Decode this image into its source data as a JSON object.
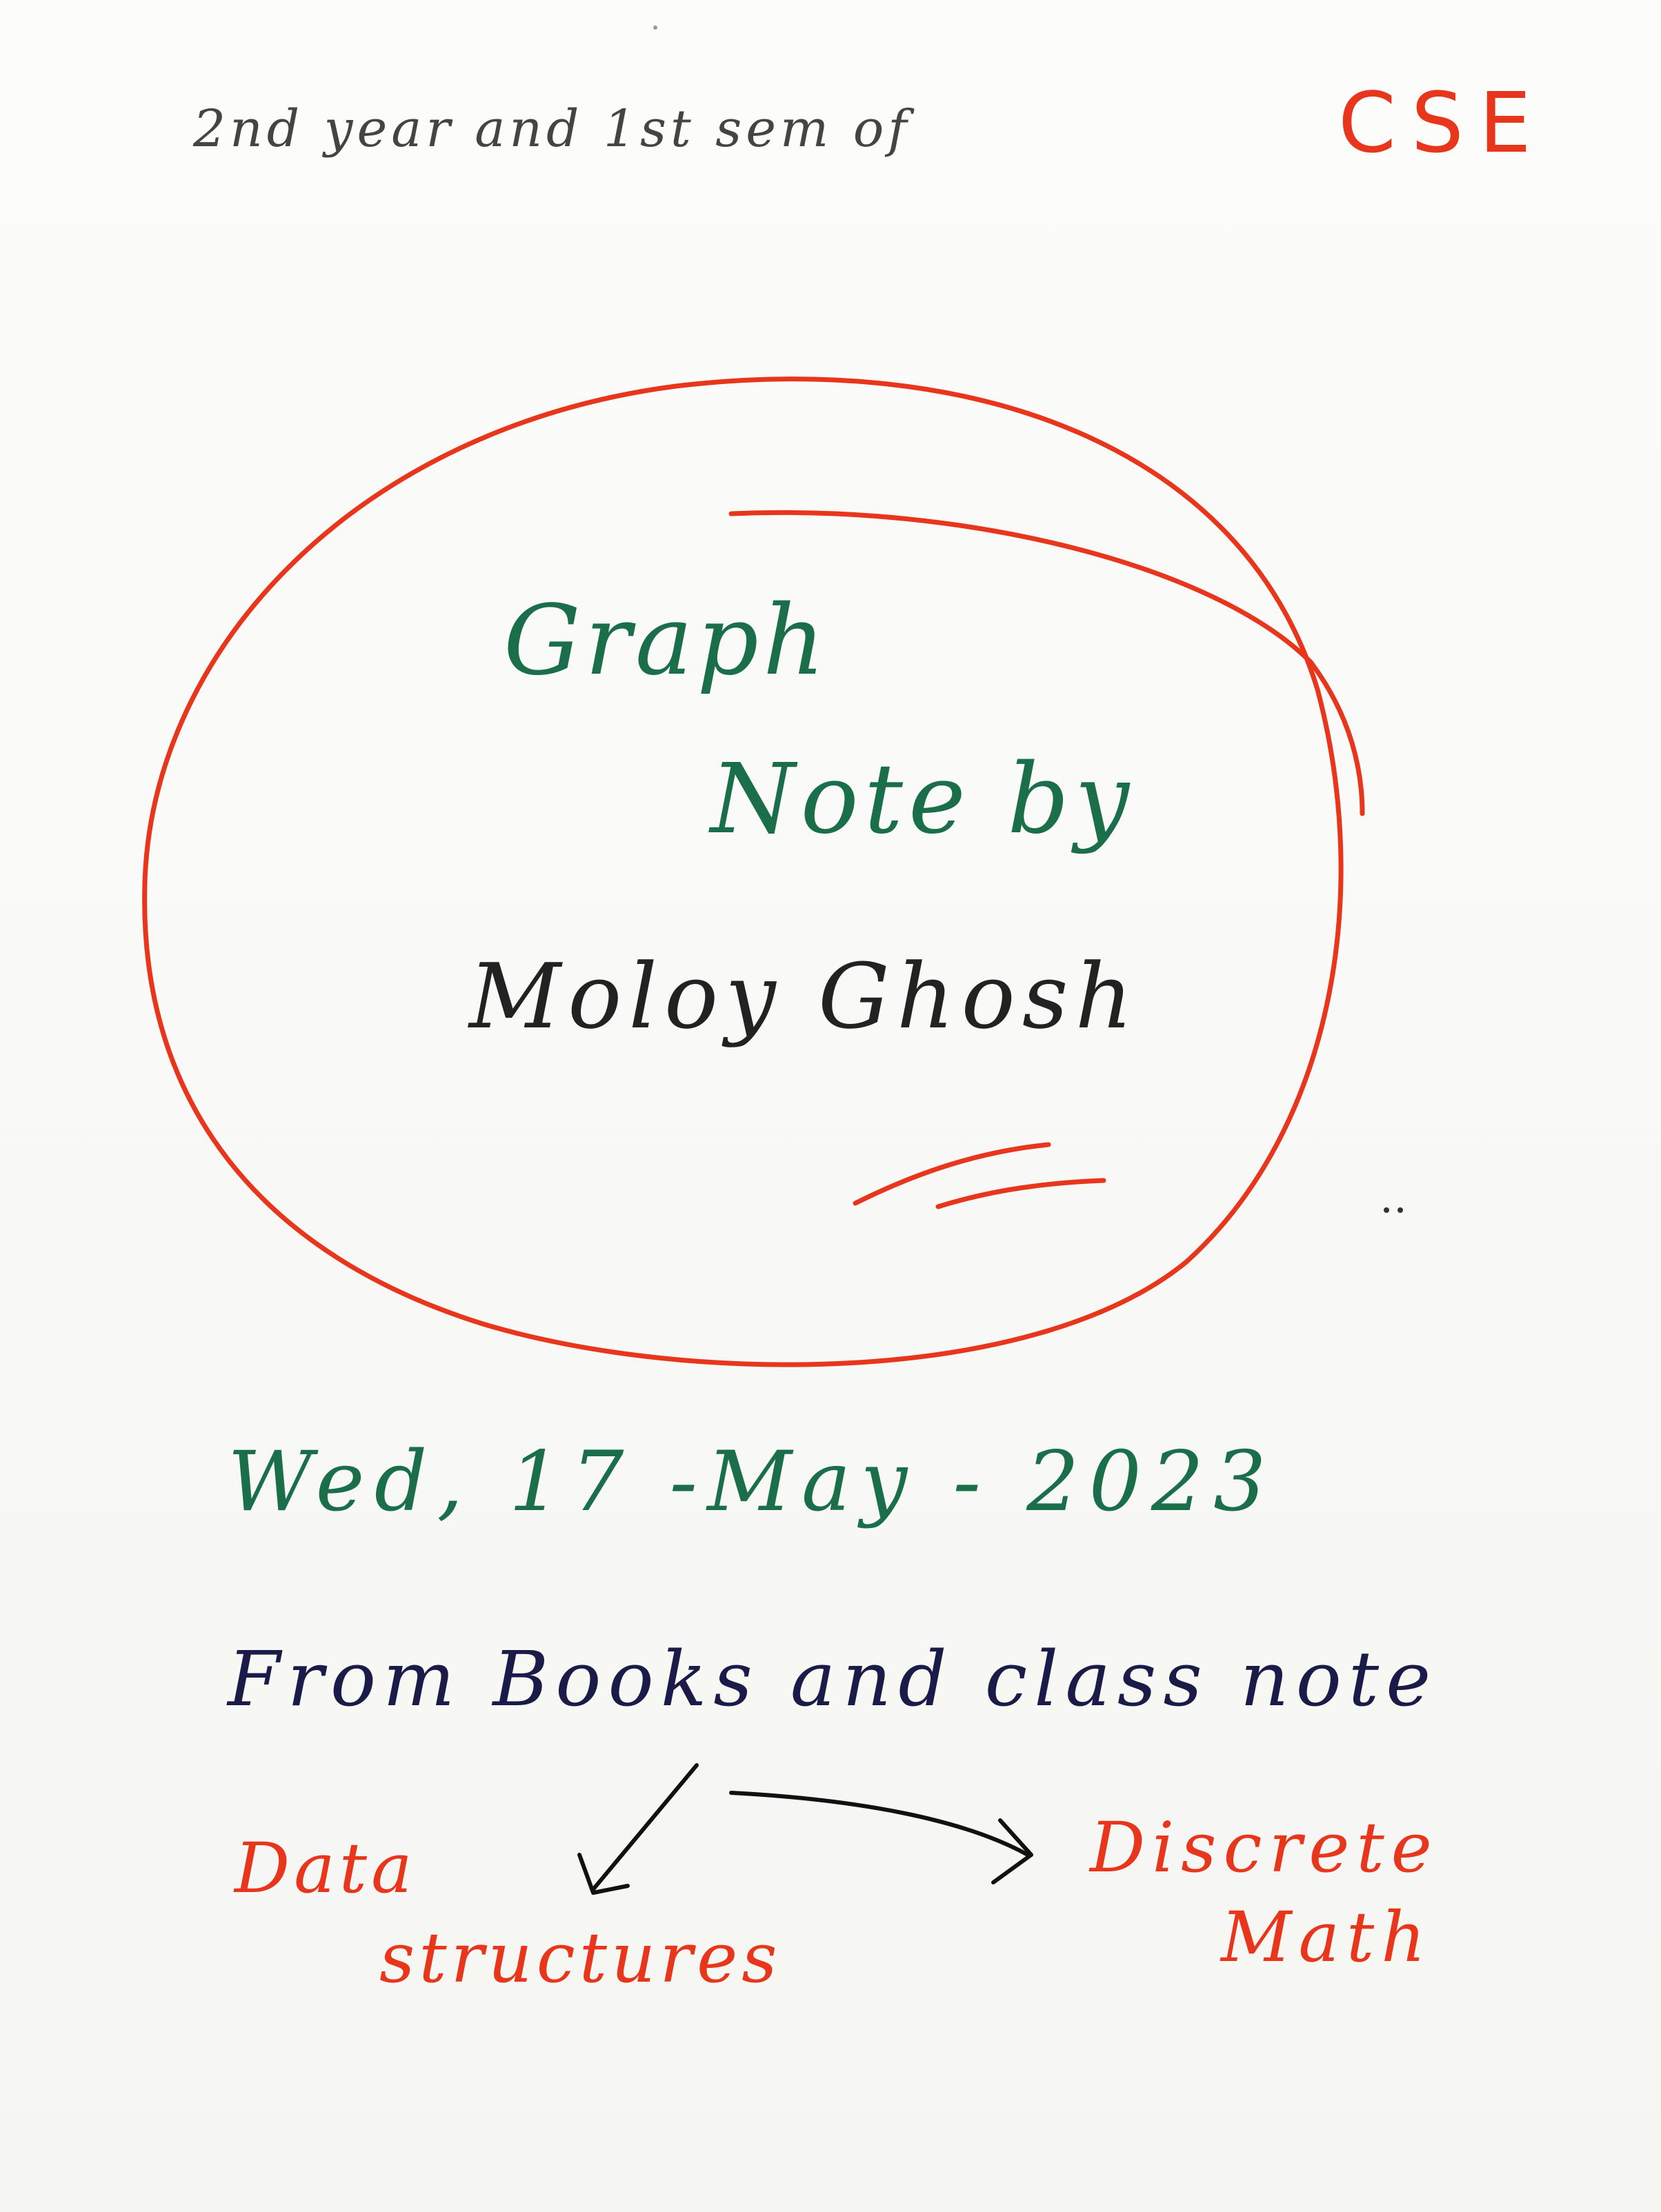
{
  "header": {
    "line1": "2nd year and 1st sem of",
    "highlight": "CSE"
  },
  "title": {
    "line1": "Graph",
    "line2": "Note by",
    "author": "Moloy Ghosh"
  },
  "date": "Wed, 17 -May - 2023",
  "source": "From Books and class note",
  "topics": {
    "left_line1": "Data",
    "left_line2": "structures",
    "right_line1": "Discrete",
    "right_line2": "Math"
  },
  "colors": {
    "red_ink": "#e8361c",
    "green_ink": "#1a6e4a",
    "navy_ink": "#1b1b4a",
    "black_ink": "#222222"
  }
}
